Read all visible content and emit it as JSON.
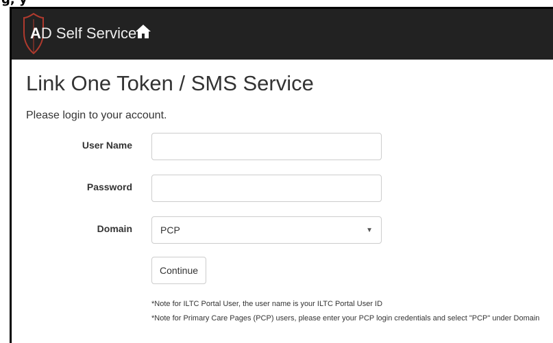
{
  "header_fragment": "g, y",
  "navbar": {
    "brand_initial": "A",
    "brand_rest": "D Self Service",
    "home_icon": "home-icon"
  },
  "main": {
    "title": "Link One Token / SMS Service",
    "subtitle": "Please login to your account."
  },
  "form": {
    "username_label": "User Name",
    "username_value": "",
    "password_label": "Password",
    "password_value": "",
    "domain_label": "Domain",
    "domain_selected": "PCP",
    "continue_label": "Continue"
  },
  "notes": [
    "*Note for ILTC Portal User, the user name is your ILTC Portal User ID",
    "*Note for Primary Care Pages (PCP) users, please enter your PCP login credentials and select \"PCP\" under Domain"
  ],
  "colors": {
    "navbar_bg": "#222222",
    "shield_red": "#c0392b"
  }
}
